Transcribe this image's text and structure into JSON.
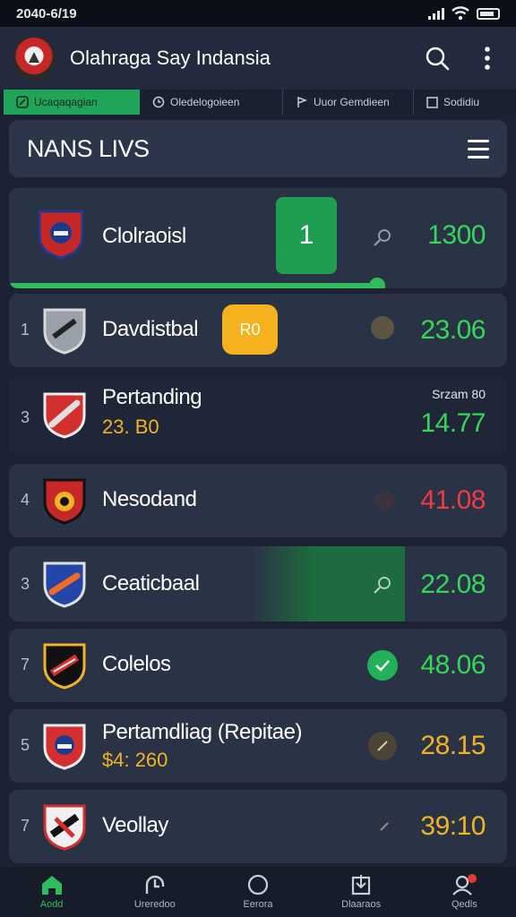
{
  "status_bar": {
    "time": "2040-6/19"
  },
  "app": {
    "title": "Olahraga Say Indansia"
  },
  "tabs": [
    {
      "label": "Ucaqaqagian"
    },
    {
      "label": "Oledelogoieen"
    },
    {
      "label": "Uuor Gemdieen"
    },
    {
      "label": "Sodidiu"
    }
  ],
  "section": {
    "title": "NANS LIVS"
  },
  "rows": [
    {
      "rank": "",
      "name": "Clolraoisl",
      "score": "1300",
      "highlight": "1"
    },
    {
      "rank": "1",
      "name": "Davdistbal",
      "score": "23.06",
      "tag": "R0"
    },
    {
      "rank": "3",
      "name": "Pertanding",
      "sub": "23. B0",
      "score": "14.77",
      "note": "Srzam 80"
    },
    {
      "rank": "4",
      "name": "Nesodand",
      "score": "41.08"
    },
    {
      "rank": "3",
      "name": "Ceaticbaal",
      "score": "22.08"
    },
    {
      "rank": "7",
      "name": "Colelos",
      "score": "48.06"
    },
    {
      "rank": "5",
      "name": "Pertamdliag (Repitae)",
      "sub": "$4: 260",
      "score": "28.15"
    },
    {
      "rank": "7",
      "name": "Veollay",
      "score": "39:10"
    }
  ],
  "progress": {
    "first_row_fraction": 0.74
  },
  "bottom_nav": [
    {
      "label": "Aodd"
    },
    {
      "label": "Ureredoo"
    },
    {
      "label": "Eerora"
    },
    {
      "label": "Dlaaraos"
    },
    {
      "label": "Qedls"
    }
  ],
  "colors": {
    "accent_green": "#35d65a",
    "accent_red": "#f03a46",
    "accent_yellow": "#f0b323",
    "card": "#2a3245",
    "background": "#1c2233"
  }
}
